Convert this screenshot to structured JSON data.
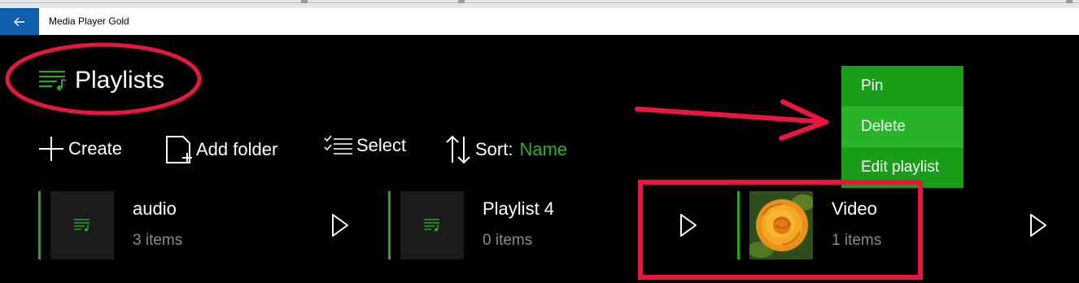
{
  "window": {
    "title": "Media Player Gold",
    "back_icon": "back-arrow-icon",
    "back_color": "#0e5fae"
  },
  "page": {
    "title": "Playlists",
    "icon": "playlist-icon"
  },
  "commands": {
    "create": "Create",
    "add_folder": "Add folder",
    "select": "Select",
    "sort_label": "Sort:",
    "sort_value": "Name"
  },
  "playlists": [
    {
      "name": "audio",
      "count": "3 items",
      "thumb": "playlist-icon"
    },
    {
      "name": "Playlist 4",
      "count": "0 items",
      "thumb": "playlist-icon"
    },
    {
      "name": "Video",
      "count": "1 items",
      "thumb": "rose-image"
    }
  ],
  "context_menu": {
    "items": [
      "Pin",
      "Delete",
      "Edit playlist"
    ],
    "highlighted": "Delete"
  },
  "colors": {
    "accent": "#22a822",
    "menu_bg": "#1a9e1a",
    "menu_highlight": "#28b428",
    "annotation": "#e8173f",
    "background": "#000000"
  }
}
